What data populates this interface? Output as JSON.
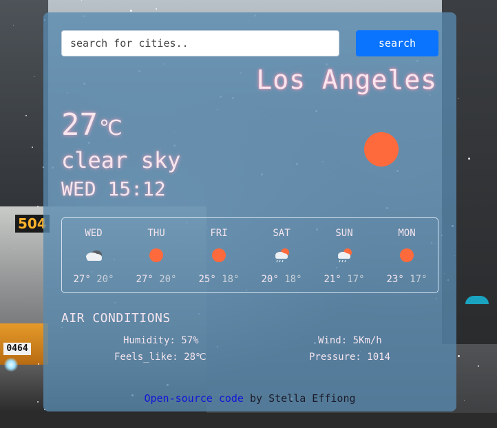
{
  "search": {
    "placeholder": "search for cities..",
    "button_label": "search"
  },
  "current": {
    "city": "Los Angeles",
    "temperature": "27",
    "unit": "℃",
    "condition": "clear sky",
    "datetime": "WED 15:12",
    "icon": "sun-icon"
  },
  "forecast": [
    {
      "day": "WED",
      "high": "27°",
      "low": "20°",
      "icon": "cloud-icon"
    },
    {
      "day": "THU",
      "high": "27°",
      "low": "20°",
      "icon": "sun-icon"
    },
    {
      "day": "FRI",
      "high": "25°",
      "low": "18°",
      "icon": "sun-icon"
    },
    {
      "day": "SAT",
      "high": "20°",
      "low": "18°",
      "icon": "rain-sun-cloud-icon"
    },
    {
      "day": "SUN",
      "high": "21°",
      "low": "17°",
      "icon": "rain-sun-cloud-icon"
    },
    {
      "day": "MON",
      "high": "23°",
      "low": "17°",
      "icon": "sun-icon"
    }
  ],
  "air_conditions": {
    "title": "AIR CONDITIONS",
    "humidity": "Humidity: 57%",
    "wind": "Wind: 5Km/h",
    "feels_like": "Feels_like: 28℃",
    "pressure": "Pressure: 1014"
  },
  "footer": {
    "link_text": "Open-source code",
    "author_text": " by Stella Effiong"
  },
  "colors": {
    "sun": "#ff6a3d",
    "search_button": "#0a74ff",
    "card": "rgba(88,138,175,0.78)",
    "link": "#1414d8"
  },
  "background_sign": {
    "bus_number": "504",
    "plate": "0464"
  }
}
